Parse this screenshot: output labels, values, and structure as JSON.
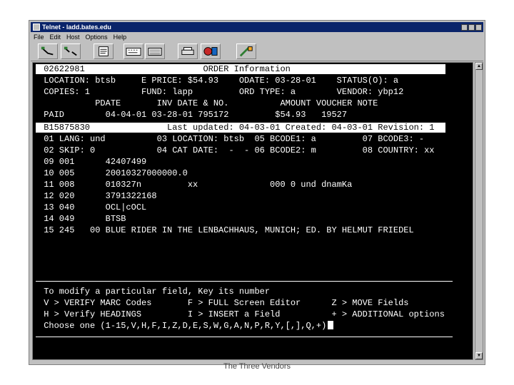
{
  "window": {
    "title": "Telnet - ladd.bates.edu",
    "menu": [
      "File",
      "Edit",
      "Host",
      "Options",
      "Help"
    ]
  },
  "toolbar": {
    "icons": [
      "connect-icon",
      "disconnect-icon",
      "text-icon",
      "keyboard-icon",
      "copy-icon",
      "print-icon",
      "settings-icon",
      "macro-icon"
    ]
  },
  "screen": {
    "lines": [
      {
        "text": " 02622981                       ORDER Information",
        "inverse": true
      },
      {
        "text": " LOCATION: btsb     E PRICE: $54.93    ODATE: 03-28-01    STATUS(O): a",
        "inverse": false
      },
      {
        "text": " COPIES: 1          FUND: lapp         ORD TYPE: a        VENDOR: ybp12",
        "inverse": false
      },
      {
        "text": "           PDATE       INV DATE & NO.          AMOUNT VOUCHER NOTE",
        "inverse": false
      },
      {
        "text": " PAID        04-04-01 03-28-01 795172         $54.93   19527",
        "inverse": false
      },
      {
        "text": " B15875830               Last updated: 04-03-01 Created: 04-03-01 Revision: 1",
        "inverse": true
      },
      {
        "text": " 01 LANG: und          03 LOCATION: btsb  05 BCODE1: a         07 BCODE3: -",
        "inverse": false
      },
      {
        "text": " 02 SKIP: 0            04 CAT DATE:  -  - 06 BCODE2: m         08 COUNTRY: xx",
        "inverse": false
      },
      {
        "text": " 09 001      42407499",
        "inverse": false
      },
      {
        "text": " 10 005      20010327000000.0",
        "inverse": false
      },
      {
        "text": " 11 008      010327n         xx              000 0 und dnamKa",
        "inverse": false
      },
      {
        "text": " 12 020      3791322168",
        "inverse": false
      },
      {
        "text": " 13 040      OCL|cOCL",
        "inverse": false
      },
      {
        "text": " 14 049      BTSB",
        "inverse": false
      },
      {
        "text": " 15 245   00 BLUE RIDER IN THE LENBACHHAUS, MUNICH; ED. BY HELMUT FRIEDEL",
        "inverse": false
      }
    ],
    "prompt": [
      " To modify a particular field, Key its number",
      " V > VERIFY MARC Codes       F > FULL Screen Editor      Z > MOVE Fields",
      " H > Verify HEADINGS         I > INSERT a Field          + > ADDITIONAL options",
      " Choose one (1-15,V,H,F,I,Z,D,E,S,W,G,A,N,P,R,Y,[,],Q,+)"
    ]
  },
  "caption": "The Three Vendors"
}
